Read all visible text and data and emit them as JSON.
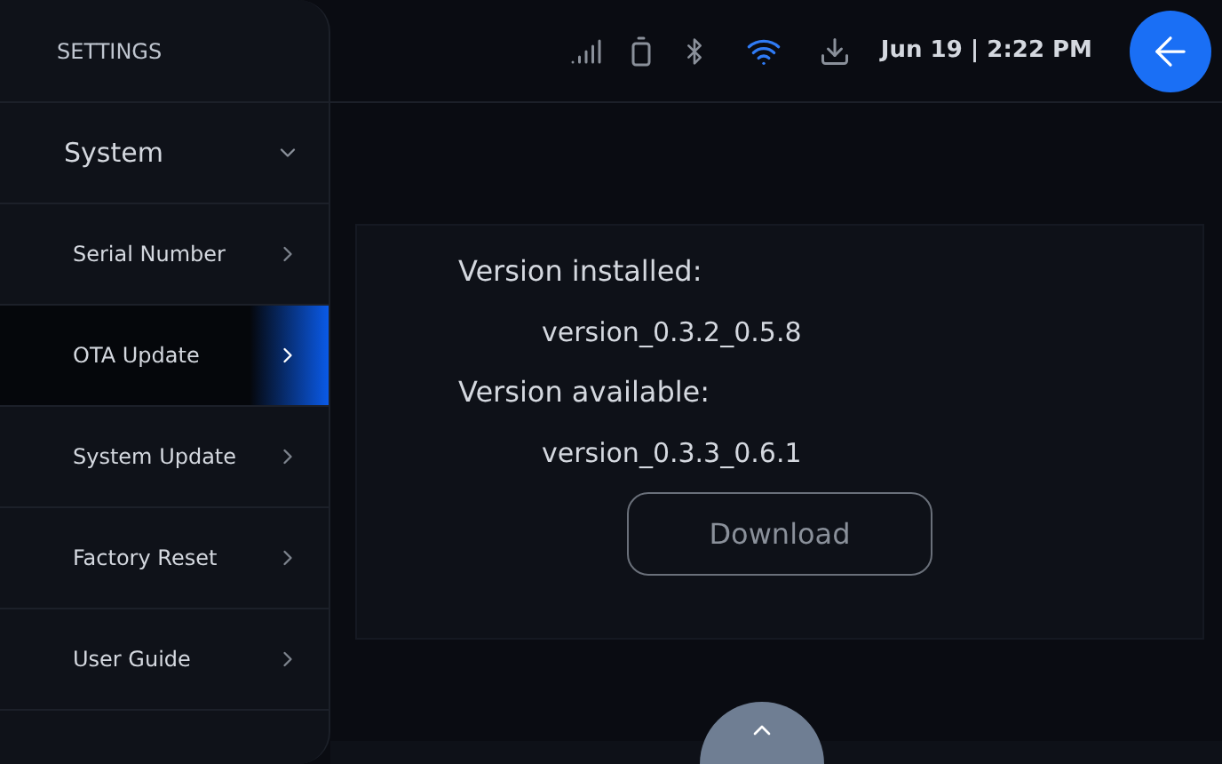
{
  "sidebar": {
    "title": "SETTINGS",
    "group": {
      "label": "System",
      "expanded": true,
      "children": [
        {
          "label": "Serial Number",
          "selected": false
        },
        {
          "label": "OTA Update",
          "selected": true
        },
        {
          "label": "System Update",
          "selected": false
        },
        {
          "label": "Factory Reset",
          "selected": false
        },
        {
          "label": "User Guide",
          "selected": false
        }
      ]
    }
  },
  "status_bar": {
    "wifi_on": true,
    "datetime": "Jun 19 | 2:22 PM"
  },
  "update_panel": {
    "installed_label": "Version installed:",
    "installed_value": "version_0.3.2_0.5.8",
    "available_label": "Version available:",
    "available_value": "version_0.3.3_0.6.1",
    "button": {
      "label": "Download",
      "disabled": true
    }
  }
}
